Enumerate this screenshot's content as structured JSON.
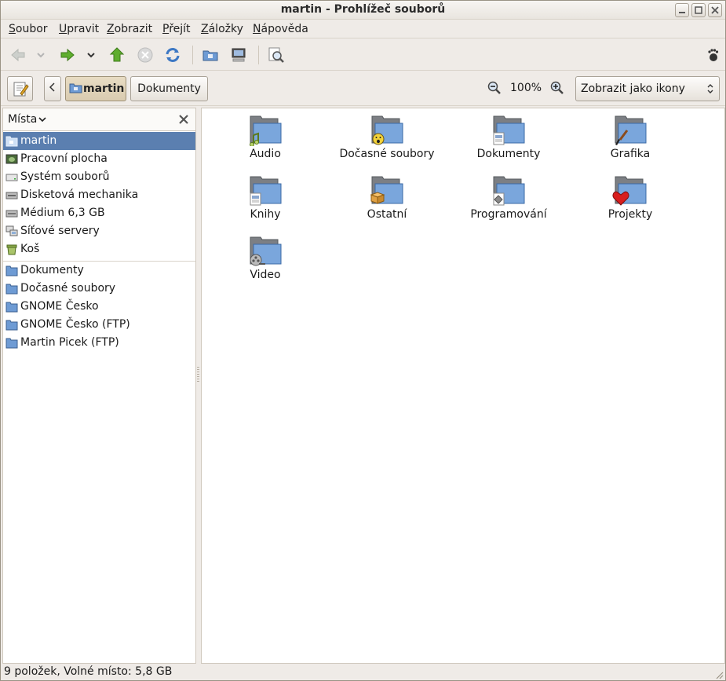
{
  "window": {
    "title": "martin - Prohlížeč souborů"
  },
  "menu": [
    {
      "key": "S",
      "rest": "oubor"
    },
    {
      "key": "U",
      "rest": "pravit"
    },
    {
      "key": "Z",
      "rest": "obrazit"
    },
    {
      "key": "P",
      "rest": "řejít"
    },
    {
      "key": "Z",
      "rest": "áložky"
    },
    {
      "key": "N",
      "rest": "ápověda"
    }
  ],
  "toolbar": {
    "icons": [
      "back-icon",
      "back-dropdown-icon",
      "forward-icon",
      "forward-dropdown-icon",
      "up-icon",
      "stop-icon",
      "reload-icon",
      "home-icon",
      "computer-icon",
      "search-icon",
      "gnome-foot-icon"
    ]
  },
  "location": {
    "path_home": "martin",
    "path_child": "Dokumenty",
    "zoom": "100%",
    "view_mode": "Zobrazit jako ikony"
  },
  "sidebar": {
    "header": "Místa",
    "places": [
      {
        "label": "martin",
        "icon": "home-folder-icon",
        "selected": true
      },
      {
        "label": "Pracovní plocha",
        "icon": "desktop-icon"
      },
      {
        "label": "Systém souborů",
        "icon": "filesystem-icon"
      },
      {
        "label": "Disketová mechanika",
        "icon": "floppy-icon"
      },
      {
        "label": "Médium 6,3 GB",
        "icon": "drive-icon"
      },
      {
        "label": "Síťové servery",
        "icon": "network-icon"
      },
      {
        "label": "Koš",
        "icon": "trash-icon"
      }
    ],
    "bookmarks": [
      {
        "label": "Dokumenty",
        "icon": "folder-icon"
      },
      {
        "label": "Dočasné soubory",
        "icon": "folder-icon"
      },
      {
        "label": "GNOME Česko",
        "icon": "folder-icon"
      },
      {
        "label": "GNOME Česko (FTP)",
        "icon": "folder-icon"
      },
      {
        "label": "Martin Picek (FTP)",
        "icon": "folder-icon"
      }
    ]
  },
  "files": [
    {
      "label": "Audio",
      "emblem": "music-note-icon"
    },
    {
      "label": "Dočasné soubory",
      "emblem": "smiley-icon"
    },
    {
      "label": "Dokumenty",
      "emblem": "document-icon"
    },
    {
      "label": "Grafika",
      "emblem": "brush-icon"
    },
    {
      "label": "Knihy",
      "emblem": "document-icon"
    },
    {
      "label": "Ostatní",
      "emblem": "package-icon"
    },
    {
      "label": "Programování",
      "emblem": "diamond-icon"
    },
    {
      "label": "Projekty",
      "emblem": "heart-icon"
    },
    {
      "label": "Video",
      "emblem": "film-reel-icon"
    }
  ],
  "status": "9 položek, Volné místo: 5,8 GB",
  "colors": {
    "selection": "#5b7fb0",
    "folder": "#6e9bd4"
  }
}
